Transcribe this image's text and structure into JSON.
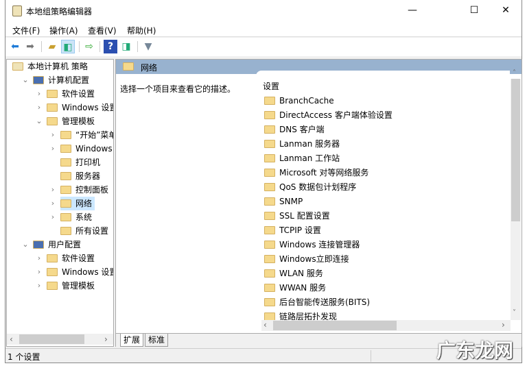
{
  "window": {
    "title": "本地组策略编辑器",
    "minimize": "—",
    "maximize": "☐",
    "close": "✕"
  },
  "menu": [
    "文件(F)",
    "操作(A)",
    "查看(V)",
    "帮助(H)"
  ],
  "tree": [
    {
      "label": "本地计算机 策略",
      "level": 0,
      "chev": ""
    },
    {
      "label": "计算机配置",
      "level": 1,
      "chev": "⌄"
    },
    {
      "label": "软件设置",
      "level": 2,
      "chev": "›"
    },
    {
      "label": "Windows 设置",
      "level": 2,
      "chev": "›"
    },
    {
      "label": "管理模板",
      "level": 2,
      "chev": "⌄"
    },
    {
      "label": "“开始”菜单和",
      "level": 3,
      "chev": "›"
    },
    {
      "label": "Windows 组件",
      "level": 3,
      "chev": "›"
    },
    {
      "label": "打印机",
      "level": 3,
      "chev": ""
    },
    {
      "label": "服务器",
      "level": 3,
      "chev": ""
    },
    {
      "label": "控制面板",
      "level": 3,
      "chev": "›"
    },
    {
      "label": "网络",
      "level": 3,
      "chev": "›",
      "selected": true
    },
    {
      "label": "系统",
      "level": 3,
      "chev": "›"
    },
    {
      "label": "所有设置",
      "level": 3,
      "chev": ""
    },
    {
      "label": "用户配置",
      "level": 1,
      "chev": "⌄"
    },
    {
      "label": "软件设置",
      "level": 2,
      "chev": "›"
    },
    {
      "label": "Windows 设置",
      "level": 2,
      "chev": "›"
    },
    {
      "label": "管理模板",
      "level": 2,
      "chev": "›"
    }
  ],
  "header": {
    "title": "网络"
  },
  "description": "选择一个项目来查看它的描述。",
  "list": {
    "column": "设置",
    "items": [
      "BranchCache",
      "DirectAccess 客户端体验设置",
      "DNS 客户端",
      "Lanman 服务器",
      "Lanman 工作站",
      "Microsoft 对等网络服务",
      "QoS 数据包计划程序",
      "SNMP",
      "SSL 配置设置",
      "TCPIP 设置",
      "Windows 连接管理器",
      "Windows立即连接",
      "WLAN 服务",
      "WWAN 服务",
      "后台智能传送服务(BITS)",
      "链路层拓扑发现"
    ]
  },
  "tabs": [
    "扩展",
    "标准"
  ],
  "status": "1 个设置",
  "watermark": "广东龙网"
}
